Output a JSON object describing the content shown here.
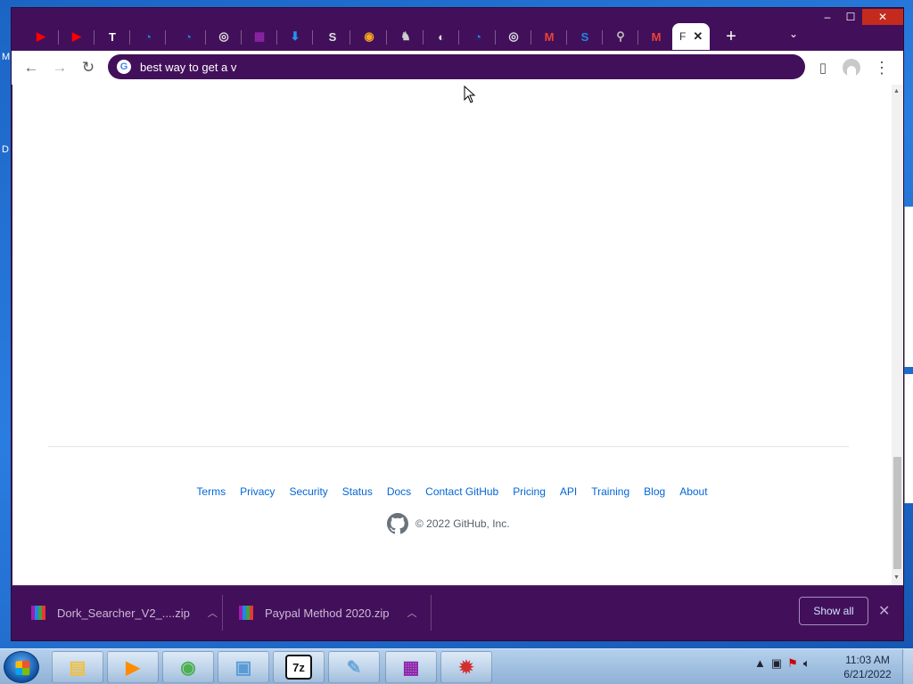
{
  "desktop": {
    "left_letters": [
      "M",
      "D"
    ]
  },
  "window": {
    "controls": {
      "minimize": "–",
      "maximize": "☐",
      "close": "✕"
    }
  },
  "tabs": [
    {
      "icon": "youtube-icon",
      "color": "#ff0000",
      "glyph": "▶"
    },
    {
      "icon": "youtube-icon",
      "color": "#ff0000",
      "glyph": "▶"
    },
    {
      "icon": "t-icon",
      "color": "#ffffff",
      "glyph": "T"
    },
    {
      "icon": "edge-icon",
      "color": "#1e88e5",
      "glyph": "◔"
    },
    {
      "icon": "edge-icon",
      "color": "#1e88e5",
      "glyph": "◔"
    },
    {
      "icon": "chrome-icon",
      "color": "#e0e0e0",
      "glyph": "◎"
    },
    {
      "icon": "winrar-icon",
      "color": "#8e24aa",
      "glyph": "▦"
    },
    {
      "icon": "download-icon",
      "color": "#2196f3",
      "glyph": "⬇"
    },
    {
      "icon": "s-logo-icon",
      "color": "#e0e0e0",
      "glyph": "S"
    },
    {
      "icon": "search-orange-icon",
      "color": "#f5a623",
      "glyph": "◉"
    },
    {
      "icon": "figure-icon",
      "color": "#cccccc",
      "glyph": "♞"
    },
    {
      "icon": "globe-icon",
      "color": "#e0e0e0",
      "glyph": "◐"
    },
    {
      "icon": "edge-icon",
      "color": "#1e88e5",
      "glyph": "◔"
    },
    {
      "icon": "chrome-icon",
      "color": "#e0e0e0",
      "glyph": "◎"
    },
    {
      "icon": "gmail-icon",
      "color": "#ea4335",
      "glyph": "M"
    },
    {
      "icon": "s-blue-icon",
      "color": "#1e88e5",
      "glyph": "S"
    },
    {
      "icon": "search-icon",
      "color": "#bbbbbb",
      "glyph": "⚲"
    },
    {
      "icon": "gmail-icon",
      "color": "#ea4335",
      "glyph": "M"
    }
  ],
  "active_tab": {
    "label": "F",
    "close": "✕"
  },
  "new_tab": "+",
  "tab_list": "⌄",
  "toolbar": {
    "back": "←",
    "forward": "→",
    "reload": "↻",
    "omnibox_text": "best way to get a v",
    "side_panel": "▯",
    "menu": "⋮"
  },
  "footer": {
    "links": [
      "Terms",
      "Privacy",
      "Security",
      "Status",
      "Docs",
      "Contact GitHub",
      "Pricing",
      "API",
      "Training",
      "Blog",
      "About"
    ],
    "copyright": "© 2022 GitHub, Inc."
  },
  "downloads": {
    "items": [
      {
        "name": "Dork_Searcher_V2_....zip"
      },
      {
        "name": "Paypal Method 2020.zip"
      }
    ],
    "show_all": "Show all",
    "close": "✕"
  },
  "taskbar": {
    "apps": [
      {
        "name": "file-explorer",
        "color": "#f0c040",
        "glyph": "▤"
      },
      {
        "name": "media-player",
        "color": "#ff8c00",
        "glyph": "▶"
      },
      {
        "name": "chrome",
        "color": "#4caf50",
        "glyph": "◉"
      },
      {
        "name": "control-panel",
        "color": "#5b9bd5",
        "glyph": "▣"
      },
      {
        "name": "7zip",
        "color": "#111111",
        "glyph": "7z"
      },
      {
        "name": "notepad",
        "color": "#6aa7d8",
        "glyph": "✎"
      },
      {
        "name": "winrar",
        "color": "#8e24aa",
        "glyph": "▦"
      },
      {
        "name": "bug-app",
        "color": "#d32f2f",
        "glyph": "✹"
      }
    ],
    "clock_time": "11:03 AM",
    "clock_date": "6/21/2022"
  }
}
